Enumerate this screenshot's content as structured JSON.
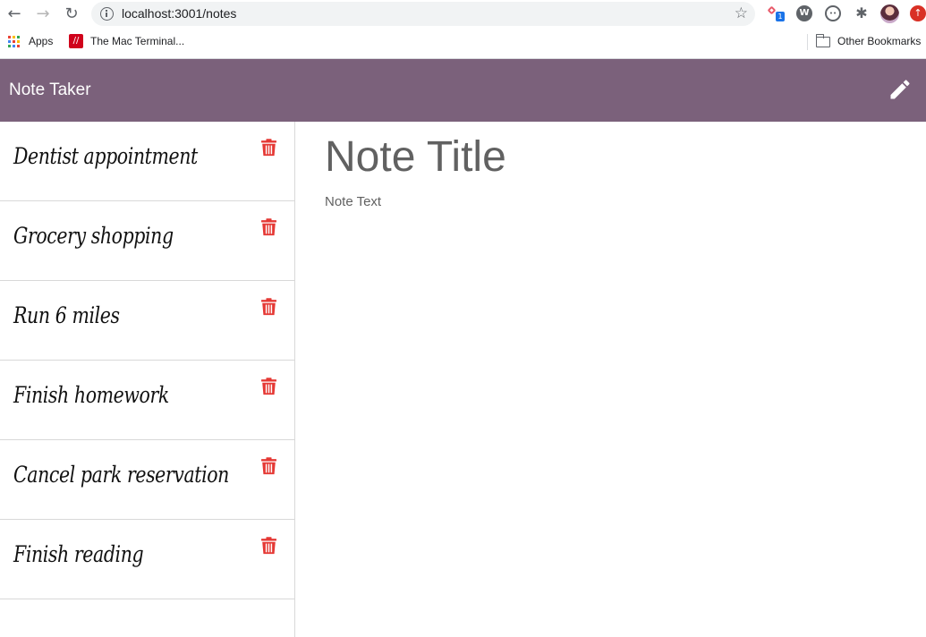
{
  "browser": {
    "url": "localhost:3001/notes",
    "bookmarks": {
      "apps_label": "Apps",
      "mac_terminal_label": "The Mac Terminal...",
      "other_label": "Other Bookmarks"
    },
    "extension_badge": "1"
  },
  "app": {
    "brand": "Note Taker",
    "header_color": "#7b617b",
    "delete_icon_color": "#e53935"
  },
  "notes": [
    {
      "title": "Dentist appointment"
    },
    {
      "title": "Grocery shopping"
    },
    {
      "title": "Run 6 miles"
    },
    {
      "title": "Finish homework"
    },
    {
      "title": "Cancel park reservation"
    },
    {
      "title": "Finish reading"
    }
  ],
  "editor": {
    "title_placeholder": "Note Title",
    "text_placeholder": "Note Text"
  },
  "icons": {
    "back": "arrow-left-icon",
    "forward": "arrow-right-icon",
    "reload": "reload-icon",
    "bookmark": "star-icon",
    "new_note": "pencil-icon",
    "delete": "trash-icon"
  }
}
